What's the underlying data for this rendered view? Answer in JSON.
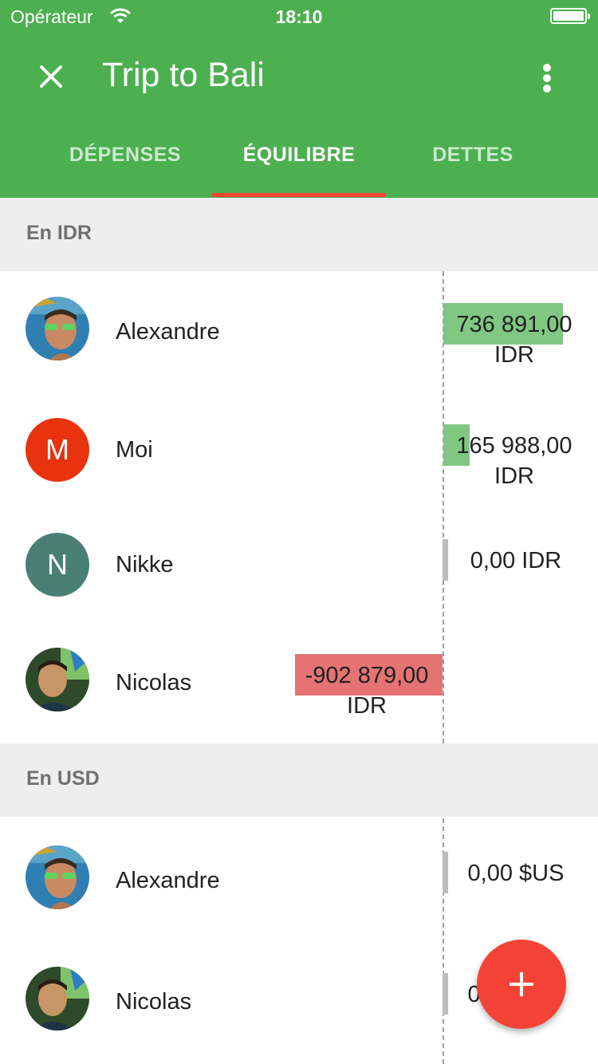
{
  "status_bar": {
    "carrier": "Opérateur",
    "time": "18:10"
  },
  "toolbar": {
    "title": "Trip to Bali"
  },
  "tabs": [
    {
      "label": "DÉPENSES",
      "active": false
    },
    {
      "label": "ÉQUILIBRE",
      "active": true
    },
    {
      "label": "DETTES",
      "active": false
    }
  ],
  "sections": [
    {
      "title": "En IDR",
      "rows": [
        {
          "name": "Alexandre",
          "avatar": "photo",
          "amount_line1": "736 891,00",
          "amount_line2": "IDR",
          "balance": 736891.0
        },
        {
          "name": "Moi",
          "avatar": "M",
          "avatar_color": "#e8330e",
          "amount_line1": "165 988,00",
          "amount_line2": "IDR",
          "balance": 165988.0
        },
        {
          "name": "Nikke",
          "avatar": "N",
          "avatar_color": "#4a7f74",
          "amount": "0,00 IDR",
          "balance": 0
        },
        {
          "name": "Nicolas",
          "avatar": "photo",
          "amount_line1": "-902 879,00",
          "amount_line2": "IDR",
          "balance": -902879.0
        }
      ]
    },
    {
      "title": "En USD",
      "rows": [
        {
          "name": "Alexandre",
          "avatar": "photo",
          "amount": "0,00 $US",
          "balance": 0
        },
        {
          "name": "Nicolas",
          "avatar": "photo",
          "amount": "0,00 $US",
          "balance": 0
        }
      ]
    }
  ],
  "colors": {
    "primary": "#4caf50",
    "accent": "#f44336",
    "positive": "#81c784",
    "negative": "#e57373",
    "zero": "#bdbdbd"
  }
}
